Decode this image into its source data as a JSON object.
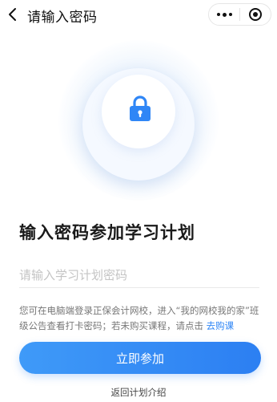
{
  "header": {
    "title": "请输入密码",
    "back_icon": "chevron-left-icon",
    "more_icon": "more-dots-icon",
    "close_icon": "target-close-icon"
  },
  "hero": {
    "icon": "lock-icon",
    "accent_color": "#2f86f6"
  },
  "main": {
    "heading": "输入密码参加学习计划",
    "password_input": {
      "value": "",
      "placeholder": "请输入学习计划密码"
    },
    "tip": {
      "text": "您可在电脑端登录正保会计网校，进入“我的网校我的家”班级公告查看打卡密码；若未购买课程，请点击",
      "link_label": "去购课"
    },
    "join_button_label": "立即参加",
    "back_link_label": "返回计划介绍"
  },
  "colors": {
    "primary": "#2f86f6",
    "text": "#1a1a1a",
    "muted": "#777777",
    "placeholder": "#c4c4c4"
  }
}
